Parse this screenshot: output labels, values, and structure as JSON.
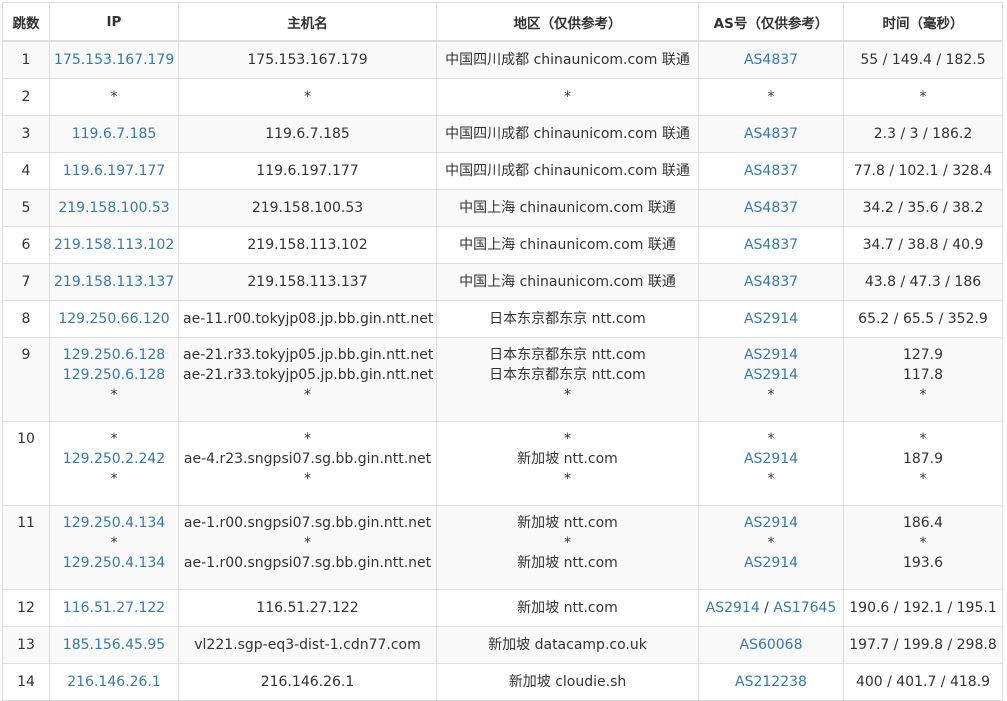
{
  "table": {
    "headers": [
      "跳数",
      "IP",
      "主机名",
      "地区（仅供参考）",
      "AS号（仅供参考）",
      "时间（毫秒）"
    ],
    "rows": [
      {
        "hop": "1",
        "ip": [
          "175.153.167.179"
        ],
        "host": [
          "175.153.167.179"
        ],
        "region": [
          "中国四川成都 chinaunicom.com 联通"
        ],
        "as": [
          [
            "AS4837"
          ]
        ],
        "time": [
          "55 / 149.4 / 182.5"
        ]
      },
      {
        "hop": "2",
        "ip": [
          "*"
        ],
        "host": [
          "*"
        ],
        "region": [
          "*"
        ],
        "as": [
          [
            "*"
          ]
        ],
        "time": [
          "*"
        ]
      },
      {
        "hop": "3",
        "ip": [
          "119.6.7.185"
        ],
        "host": [
          "119.6.7.185"
        ],
        "region": [
          "中国四川成都 chinaunicom.com 联通"
        ],
        "as": [
          [
            "AS4837"
          ]
        ],
        "time": [
          "2.3 / 3 / 186.2"
        ]
      },
      {
        "hop": "4",
        "ip": [
          "119.6.197.177"
        ],
        "host": [
          "119.6.197.177"
        ],
        "region": [
          "中国四川成都 chinaunicom.com 联通"
        ],
        "as": [
          [
            "AS4837"
          ]
        ],
        "time": [
          "77.8 / 102.1 / 328.4"
        ]
      },
      {
        "hop": "5",
        "ip": [
          "219.158.100.53"
        ],
        "host": [
          "219.158.100.53"
        ],
        "region": [
          "中国上海 chinaunicom.com 联通"
        ],
        "as": [
          [
            "AS4837"
          ]
        ],
        "time": [
          "34.2 / 35.6 / 38.2"
        ]
      },
      {
        "hop": "6",
        "ip": [
          "219.158.113.102"
        ],
        "host": [
          "219.158.113.102"
        ],
        "region": [
          "中国上海 chinaunicom.com 联通"
        ],
        "as": [
          [
            "AS4837"
          ]
        ],
        "time": [
          "34.7 / 38.8 / 40.9"
        ]
      },
      {
        "hop": "7",
        "ip": [
          "219.158.113.137"
        ],
        "host": [
          "219.158.113.137"
        ],
        "region": [
          "中国上海 chinaunicom.com 联通"
        ],
        "as": [
          [
            "AS4837"
          ]
        ],
        "time": [
          "43.8 / 47.3 / 186"
        ]
      },
      {
        "hop": "8",
        "ip": [
          "129.250.66.120"
        ],
        "host": [
          "ae-11.r00.tokyjp08.jp.bb.gin.ntt.net"
        ],
        "region": [
          "日本东京都东京 ntt.com"
        ],
        "as": [
          [
            "AS2914"
          ]
        ],
        "time": [
          "65.2 / 65.5 / 352.9"
        ]
      },
      {
        "hop": "9",
        "ip": [
          "129.250.6.128",
          "129.250.6.128",
          "*"
        ],
        "host": [
          "ae-21.r33.tokyjp05.jp.bb.gin.ntt.net",
          "ae-21.r33.tokyjp05.jp.bb.gin.ntt.net",
          "*"
        ],
        "region": [
          "日本东京都东京 ntt.com",
          "日本东京都东京 ntt.com",
          "*"
        ],
        "as": [
          [
            "AS2914"
          ],
          [
            "AS2914"
          ],
          [
            "*"
          ]
        ],
        "time": [
          "127.9",
          "117.8",
          "*"
        ]
      },
      {
        "hop": "10",
        "ip": [
          "*",
          "129.250.2.242",
          "*"
        ],
        "host": [
          "*",
          "ae-4.r23.sngpsi07.sg.bb.gin.ntt.net",
          "*"
        ],
        "region": [
          "*",
          "新加坡 ntt.com",
          "*"
        ],
        "as": [
          [
            "*"
          ],
          [
            "AS2914"
          ],
          [
            "*"
          ]
        ],
        "time": [
          "*",
          "187.9",
          "*"
        ]
      },
      {
        "hop": "11",
        "ip": [
          "129.250.4.134",
          "*",
          "129.250.4.134"
        ],
        "host": [
          "ae-1.r00.sngpsi07.sg.bb.gin.ntt.net",
          "*",
          "ae-1.r00.sngpsi07.sg.bb.gin.ntt.net"
        ],
        "region": [
          "新加坡 ntt.com",
          "*",
          "新加坡 ntt.com"
        ],
        "as": [
          [
            "AS2914"
          ],
          [
            "*"
          ],
          [
            "AS2914"
          ]
        ],
        "time": [
          "186.4",
          "*",
          "193.6"
        ]
      },
      {
        "hop": "12",
        "ip": [
          "116.51.27.122"
        ],
        "host": [
          "116.51.27.122"
        ],
        "region": [
          "新加坡 ntt.com"
        ],
        "as": [
          [
            "AS2914",
            "AS17645"
          ]
        ],
        "time": [
          "190.6 / 192.1 / 195.1"
        ]
      },
      {
        "hop": "13",
        "ip": [
          "185.156.45.95"
        ],
        "host": [
          "vl221.sgp-eq3-dist-1.cdn77.com"
        ],
        "region": [
          "新加坡 datacamp.co.uk"
        ],
        "as": [
          [
            "AS60068"
          ]
        ],
        "time": [
          "197.7 / 199.8 / 298.8"
        ]
      },
      {
        "hop": "14",
        "ip": [
          "216.146.26.1"
        ],
        "host": [
          "216.146.26.1"
        ],
        "region": [
          "新加坡 cloudie.sh"
        ],
        "as": [
          [
            "AS212238"
          ]
        ],
        "time": [
          "400 / 401.7 / 418.9"
        ]
      }
    ]
  },
  "colors": {
    "link": "#337ab7",
    "text": "#333333",
    "border": "#dddddd",
    "stripe": "#f9f9f9"
  }
}
